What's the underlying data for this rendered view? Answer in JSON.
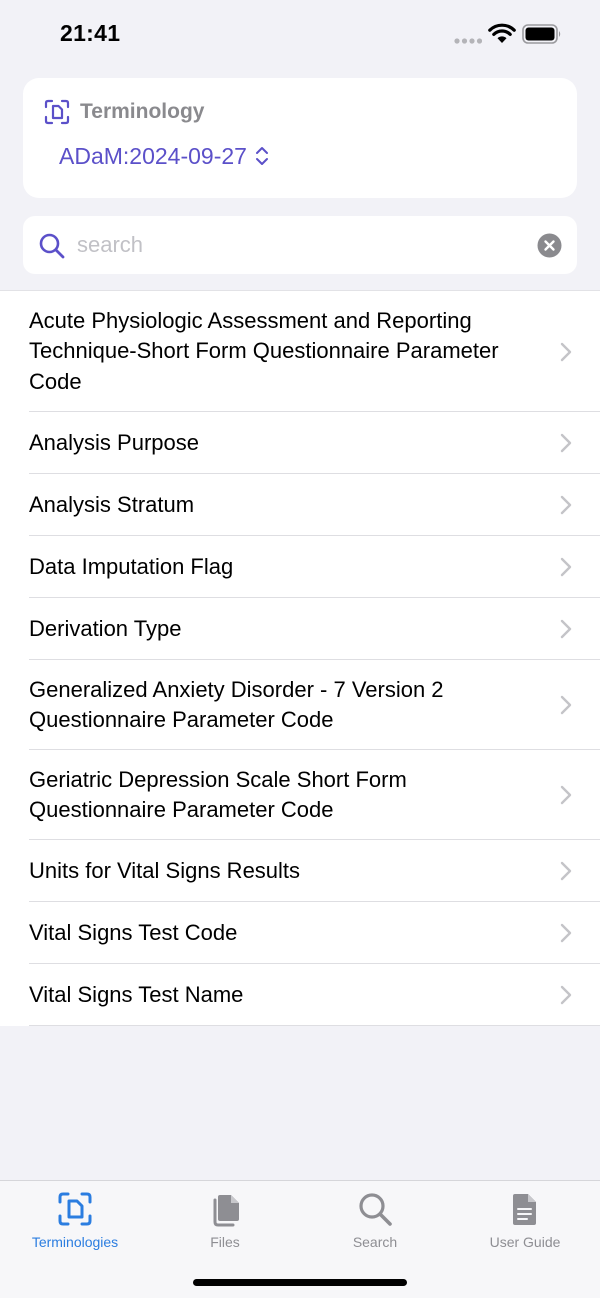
{
  "status_bar": {
    "time": "21:41"
  },
  "terminology_card": {
    "label": "Terminology",
    "selected_version": "ADaM:2024-09-27"
  },
  "search": {
    "placeholder": "search",
    "value": ""
  },
  "list": {
    "items": [
      {
        "label": "Acute Physiologic Assessment and Reporting Technique-Short Form Questionnaire Parameter Code"
      },
      {
        "label": "Analysis Purpose"
      },
      {
        "label": "Analysis Stratum"
      },
      {
        "label": "Data Imputation Flag"
      },
      {
        "label": "Derivation Type"
      },
      {
        "label": "Generalized Anxiety Disorder - 7 Version 2 Questionnaire Parameter Code"
      },
      {
        "label": "Geriatric Depression Scale Short Form Questionnaire Parameter Code"
      },
      {
        "label": "Units for Vital Signs Results"
      },
      {
        "label": "Vital Signs Test Code"
      },
      {
        "label": "Vital Signs Test Name"
      }
    ]
  },
  "tab_bar": {
    "tabs": [
      {
        "label": "Terminologies",
        "icon": "scan-doc-icon",
        "active": true
      },
      {
        "label": "Files",
        "icon": "files-icon",
        "active": false
      },
      {
        "label": "Search",
        "icon": "magnifier-icon",
        "active": false
      },
      {
        "label": "User Guide",
        "icon": "document-icon",
        "active": false
      }
    ]
  },
  "colors": {
    "accent": "#5b50c9",
    "tab_active": "#2b7de0",
    "tab_inactive": "#8e8e93",
    "background": "#f2f2f7"
  }
}
